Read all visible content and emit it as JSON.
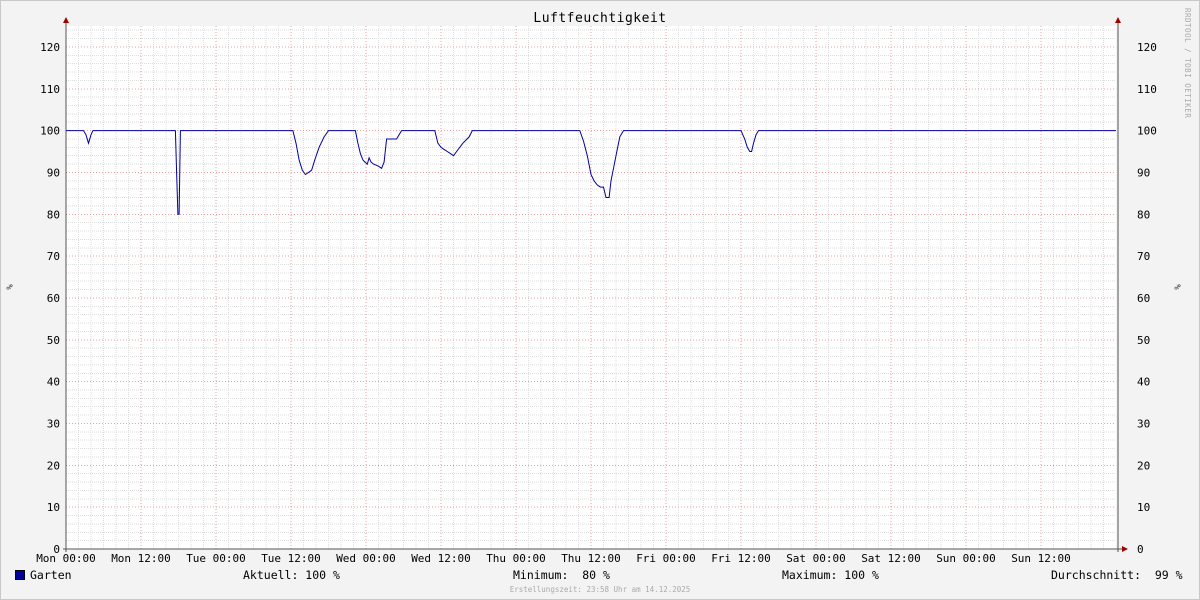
{
  "chart_data": {
    "type": "line",
    "title": "Luftfeuchtigkeit",
    "ylabel": "%",
    "ylim": [
      0,
      125
    ],
    "yticks": [
      0,
      10,
      20,
      30,
      40,
      50,
      60,
      70,
      80,
      90,
      100,
      110,
      120
    ],
    "xlim": [
      0,
      168
    ],
    "xticks": [
      {
        "hour": 0,
        "label": "Mon 00:00"
      },
      {
        "hour": 12,
        "label": "Mon 12:00"
      },
      {
        "hour": 24,
        "label": "Tue 00:00"
      },
      {
        "hour": 36,
        "label": "Tue 12:00"
      },
      {
        "hour": 48,
        "label": "Wed 00:00"
      },
      {
        "hour": 60,
        "label": "Wed 12:00"
      },
      {
        "hour": 72,
        "label": "Thu 00:00"
      },
      {
        "hour": 84,
        "label": "Thu 12:00"
      },
      {
        "hour": 96,
        "label": "Fri 00:00"
      },
      {
        "hour": 108,
        "label": "Fri 12:00"
      },
      {
        "hour": 120,
        "label": "Sat 00:00"
      },
      {
        "hour": 132,
        "label": "Sat 12:00"
      },
      {
        "hour": 144,
        "label": "Sun 00:00"
      },
      {
        "hour": 156,
        "label": "Sun 12:00"
      }
    ],
    "grid": true,
    "series": [
      {
        "name": "Garten",
        "color": "#0000a0",
        "x": [
          0,
          2.8,
          3.2,
          3.6,
          4.0,
          4.3,
          17.5,
          17.7,
          17.9,
          18.1,
          18.3,
          18.5,
          36.3,
          36.8,
          37.3,
          37.8,
          38.3,
          38.8,
          39.3,
          39.8,
          40.5,
          41.3,
          42.0,
          42.5,
          42.8,
          46.3,
          46.7,
          47.1,
          47.5,
          47.8,
          48.2,
          48.5,
          48.8,
          49.2,
          50.0,
          50.5,
          50.9,
          51.3,
          52.0,
          52.9,
          53.3,
          53.7,
          59.0,
          59.5,
          60.0,
          60.5,
          61.0,
          61.5,
          62.0,
          62.5,
          63.5,
          64.5,
          65.0,
          82.2,
          82.8,
          83.4,
          84.0,
          84.5,
          85.0,
          85.5,
          86.0,
          86.4,
          86.6,
          86.9,
          87.2,
          87.6,
          88.0,
          88.6,
          89.2,
          108.0,
          108.6,
          109.0,
          109.4,
          109.7,
          110.0,
          110.4,
          110.8,
          168
        ],
        "y": [
          100,
          100,
          99,
          97,
          99,
          100,
          100,
          90,
          80,
          80,
          100,
          100,
          100,
          97,
          93,
          90.5,
          89.5,
          90,
          90.5,
          93,
          96,
          98.5,
          100,
          100,
          100,
          100,
          97,
          94.5,
          93,
          92.5,
          92,
          93.5,
          92.5,
          92,
          91.5,
          91,
          92.5,
          98,
          98,
          98,
          99,
          100,
          100,
          97,
          96,
          95.5,
          95,
          94.5,
          94,
          95,
          97,
          98.5,
          100,
          100,
          97.5,
          94,
          89.5,
          88,
          87,
          86.5,
          86.5,
          84,
          84,
          84,
          88,
          91,
          94,
          98.5,
          100,
          100,
          98,
          96,
          95,
          95,
          97,
          99,
          100,
          100
        ]
      }
    ]
  },
  "legend": {
    "series_name": "Garten",
    "current": "Aktuell: 100 %",
    "minimum": "Minimum:  80 %",
    "maximum": "Maximum: 100 %",
    "average": "Durchschnitt:  99 %"
  },
  "watermark": "RRDTOOL / TOBI OETIKER",
  "footer": "Erstellungszeit: 23:58 Uhr am 14.12.2025"
}
